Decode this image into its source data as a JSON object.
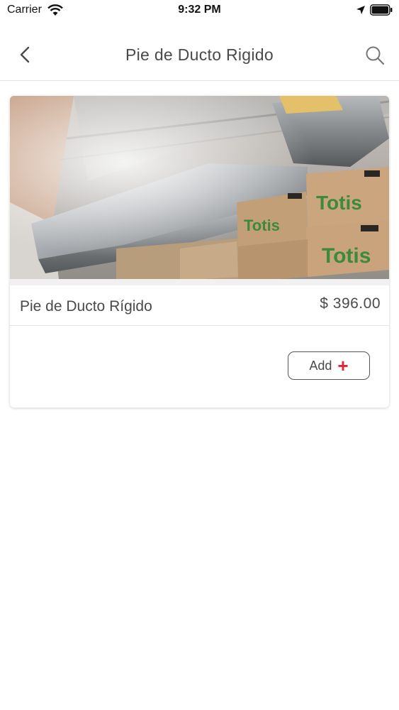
{
  "status_bar": {
    "carrier": "Carrier",
    "time": "9:32 PM"
  },
  "nav": {
    "title": "Pie de Ducto Rigido",
    "back_icon": "chevron-left-icon",
    "search_icon": "search-icon"
  },
  "product": {
    "name": "Pie de Ducto Rígido",
    "price": "$ 396.00",
    "image_box_text": "Totis",
    "add_label": "Add",
    "add_icon": "plus-icon"
  },
  "colors": {
    "accent": "#e0262c",
    "text": "#4a4a4a",
    "divider": "#e3e3e3"
  }
}
